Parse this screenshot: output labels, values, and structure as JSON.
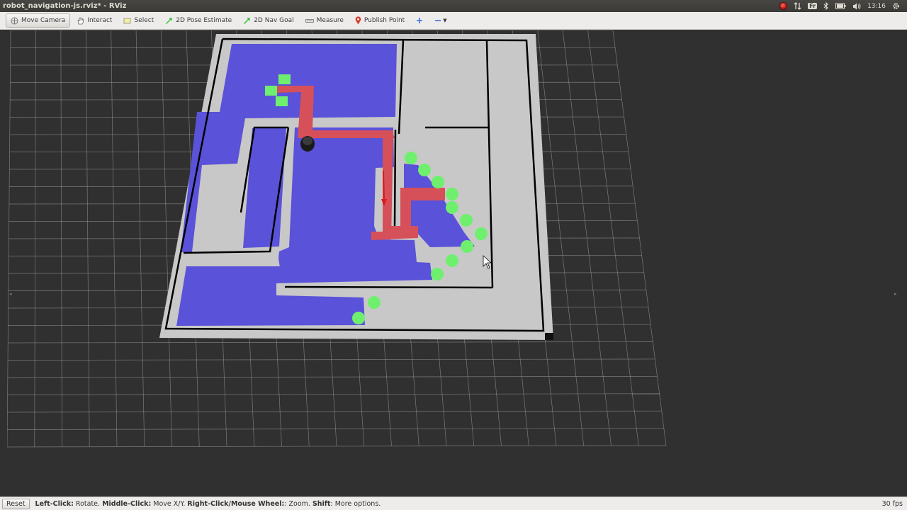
{
  "window": {
    "title": "robot_navigation-js.rviz* - RViz"
  },
  "tray": {
    "keyboard": "Fr",
    "clock": "13:16"
  },
  "toolbar": {
    "tools": [
      {
        "label": "Move Camera",
        "icon": "move-camera-icon"
      },
      {
        "label": "Interact",
        "icon": "hand-icon"
      },
      {
        "label": "Select",
        "icon": "select-box-icon"
      },
      {
        "label": "2D Pose Estimate",
        "icon": "green-arrow-icon"
      },
      {
        "label": "2D Nav Goal",
        "icon": "green-arrow-icon"
      },
      {
        "label": "Measure",
        "icon": "ruler-icon"
      },
      {
        "label": "Publish Point",
        "icon": "map-pin-icon"
      }
    ],
    "add_tool_icon": "plus-icon",
    "remove_tool_icon": "minus-icon"
  },
  "viewport": {
    "colors": {
      "background": "#303030",
      "grid": "#a0a0a0",
      "free_space": "#c8c8c8",
      "wall": "#000000",
      "costmap": "#5a52d8",
      "path": "#d6505a",
      "frontier": "#6ef06e"
    }
  },
  "statusbar": {
    "reset_label": "Reset",
    "hint_parts": [
      {
        "key": "Left-Click:",
        "text": " Rotate. "
      },
      {
        "key": "Middle-Click:",
        "text": " Move X/Y. "
      },
      {
        "key": "Right-Click/Mouse Wheel:",
        "text": ": Zoom. "
      },
      {
        "key": "Shift",
        "text": ": More options."
      }
    ],
    "fps": "30 fps"
  }
}
